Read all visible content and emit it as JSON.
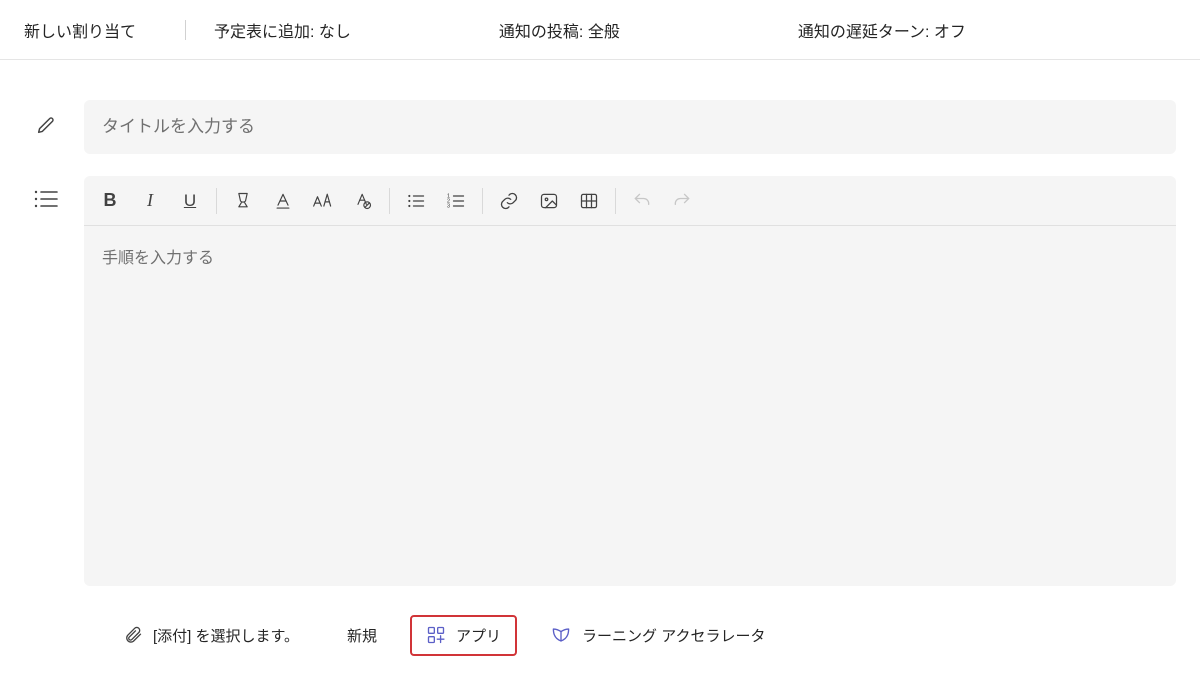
{
  "header": {
    "title": "新しい割り当て",
    "calendar": "予定表に追加: なし",
    "notify_post": "通知の投稿: 全般",
    "notify_delay": "通知の遅延ターン: オフ"
  },
  "title_field": {
    "placeholder": "タイトルを入力する",
    "value": ""
  },
  "editor": {
    "placeholder": "手順を入力する"
  },
  "toolbar": {
    "bold": "B",
    "italic": "I",
    "underline": "U"
  },
  "footer": {
    "attach_label": "[添付] を選択します。",
    "new_label": "新規",
    "apps_label": "アプリ",
    "learn_label": "ラーニング アクセラレータ"
  }
}
